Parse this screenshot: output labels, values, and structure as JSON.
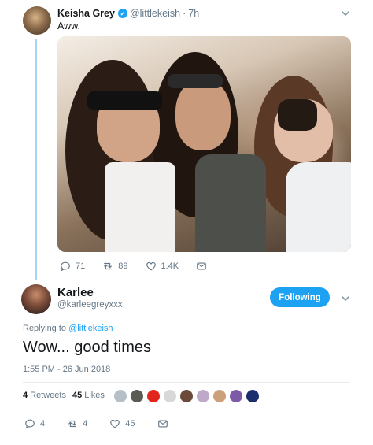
{
  "tweet1": {
    "name": "Keisha Grey",
    "handle": "@littlekeish",
    "separator": "·",
    "time": "7h",
    "text": "Aww.",
    "actions": {
      "replies": "71",
      "retweets": "89",
      "likes": "1.4K"
    }
  },
  "tweet2": {
    "name": "Karlee",
    "handle": "@karleegreyxxx",
    "follow_label": "Following",
    "replying_prefix": "Replying to",
    "replying_to": "@littlekeish",
    "text": "Wow... good times",
    "timestamp": "1:55 PM - 26 Jun 2018",
    "retweets_count": "4",
    "retweets_label": "Retweets",
    "likes_count": "45",
    "likes_label": "Likes",
    "actions": {
      "replies": "4",
      "retweets": "4",
      "likes": "45"
    }
  },
  "colors": {
    "accent": "#1da1f2",
    "thread_line": "#a6d4f2",
    "secondary_text": "#657786"
  },
  "likers": [
    "#b7bfc6",
    "#5b5b55",
    "#e0261c",
    "#d8d8d8",
    "#6b4a3a",
    "#bfa9c8",
    "#caa17a",
    "#7d5aa8",
    "#1b2d6e"
  ]
}
